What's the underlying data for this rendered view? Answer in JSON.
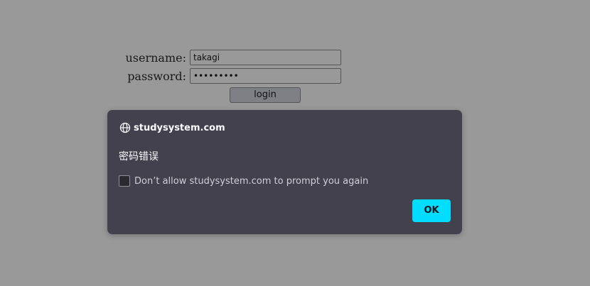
{
  "login_form": {
    "username_label": "username:",
    "username_value": "takagi",
    "password_label": "password:",
    "password_value": "•••••••••",
    "login_button_label": "login"
  },
  "dialog": {
    "icon": "globe-icon",
    "origin": "studysystem.com",
    "message": "密码错误",
    "checkbox_label": "Don’t allow studysystem.com to prompt you again",
    "checkbox_checked": false,
    "ok_label": "OK",
    "colors": {
      "background": "#42414d",
      "accent": "#00ddff",
      "text": "#fbfbfe"
    }
  },
  "page": {
    "background": "#999999"
  }
}
